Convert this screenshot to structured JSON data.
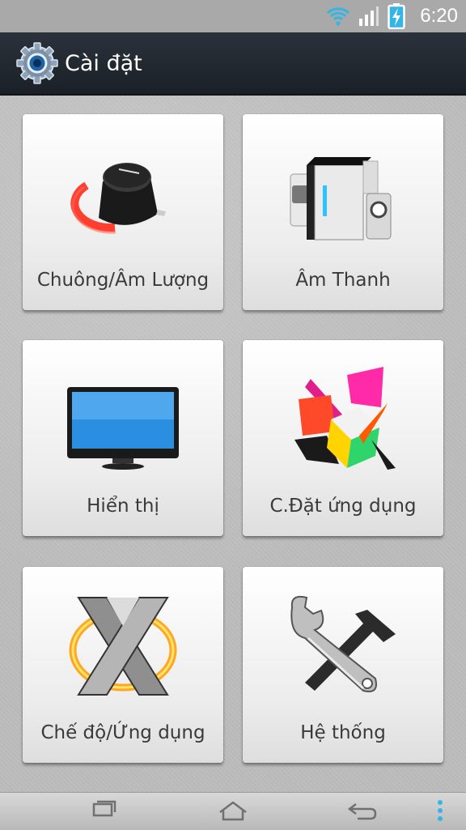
{
  "status": {
    "time": "6:20"
  },
  "header": {
    "title": "Cài đặt"
  },
  "tiles": [
    {
      "label": "Chuông/Âm Lượng",
      "icon": "volume-knob-icon"
    },
    {
      "label": "Âm Thanh",
      "icon": "speakers-icon"
    },
    {
      "label": "Hiển thị",
      "icon": "monitor-icon"
    },
    {
      "label": "C.Đặt ứng dụng",
      "icon": "app-cubes-icon"
    },
    {
      "label": "Chế độ/Ứng dụng",
      "icon": "x-mode-icon"
    },
    {
      "label": "Hệ thống",
      "icon": "wrench-hammer-icon"
    }
  ],
  "nav": [
    "recent-apps-icon",
    "home-icon",
    "back-icon",
    "menu-dots-icon"
  ],
  "colors": {
    "action_bar": "#1f252d",
    "accent_red": "#e8231c",
    "accent_cyan": "#33b5e5"
  }
}
